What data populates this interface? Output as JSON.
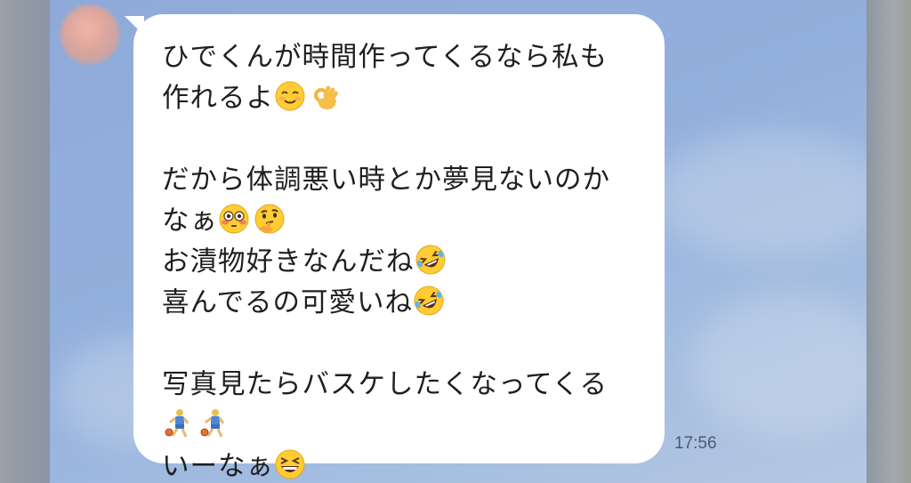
{
  "message": {
    "lines": [
      {
        "text": "ひでくんが時間作ってくるなら私も",
        "emojis": []
      },
      {
        "text": "作れるよ",
        "emojis": [
          "smiling-face-icon",
          "ok-hand-icon"
        ]
      },
      {
        "text": "",
        "emojis": []
      },
      {
        "text": "だから体調悪い時とか夢見ないのか",
        "emojis": []
      },
      {
        "text": "なぁ",
        "emojis": [
          "flushed-face-icon",
          "thinking-face-icon"
        ]
      },
      {
        "text": "お漬物好きなんだね",
        "emojis": [
          "rolling-laughing-icon"
        ]
      },
      {
        "text": "喜んでるの可愛いね",
        "emojis": [
          "rolling-laughing-icon"
        ]
      },
      {
        "text": "",
        "emojis": []
      },
      {
        "text": "写真見たらバスケしたくなってくる",
        "emojis": []
      },
      {
        "text": "",
        "emojis": [
          "basketball-player-icon",
          "basketball-player-icon"
        ]
      },
      {
        "text": "いーなぁ",
        "emojis": [
          "grinning-squinting-icon"
        ]
      }
    ],
    "time": "17:56"
  },
  "colors": {
    "chat_background": "#93b0dd",
    "bubble": "#ffffff",
    "text": "#1f1f1f",
    "timestamp": "#4c5a70"
  }
}
